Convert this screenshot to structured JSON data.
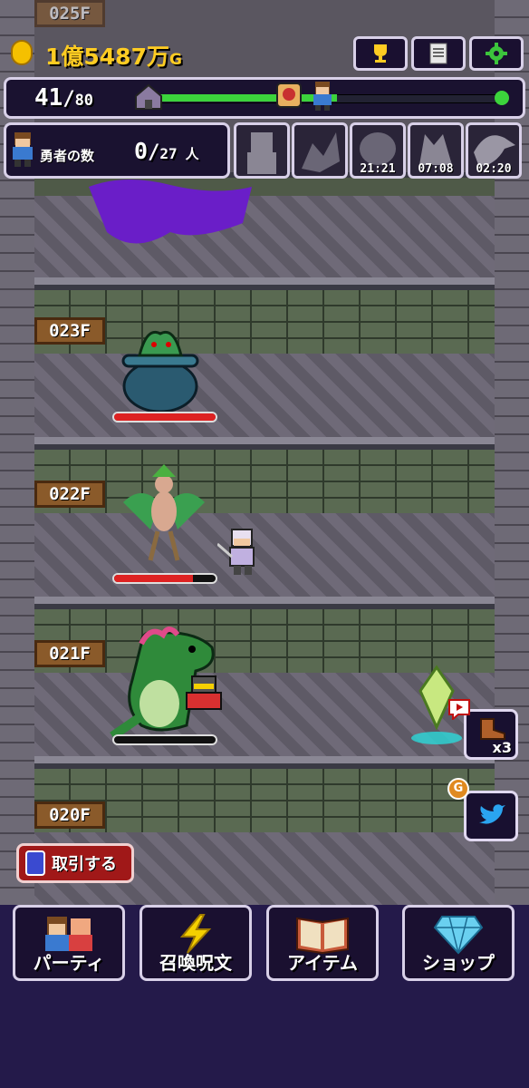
{
  "header": {
    "gold_amount": "1億5487万",
    "gold_unit": "G",
    "buttons": {
      "trophy": "trophy-icon",
      "quest": "document-icon",
      "settings": "gear-icon"
    }
  },
  "progress": {
    "current": "41",
    "separator": "/",
    "max": "80",
    "fraction": 0.5125
  },
  "heroes": {
    "label": "勇者の数",
    "count": "0",
    "separator": "/",
    "total": "27",
    "unit": "人"
  },
  "bosses": [
    {
      "name_icon": "knight-silhouette",
      "timer": ""
    },
    {
      "name_icon": "dragon-silhouette",
      "timer": ""
    },
    {
      "name_icon": "beast-silhouette",
      "timer": "21:21"
    },
    {
      "name_icon": "wolf-silhouette",
      "timer": "07:08"
    },
    {
      "name_icon": "bird-silhouette",
      "timer": "02:20"
    }
  ],
  "floors": [
    {
      "label": "025F",
      "monster": "purple-slime-puddle"
    },
    {
      "label": "023F",
      "monster": "pot-plant",
      "hp": 1.0
    },
    {
      "label": "022F",
      "monster": "harpy",
      "hp": 0.78
    },
    {
      "label": "021F",
      "monster": "green-dinosaur",
      "hp": 0.0
    },
    {
      "label": "020F",
      "monster": "none"
    }
  ],
  "side_buttons": {
    "boost_label": "x3",
    "twitter_badge": "G"
  },
  "trade": {
    "label": "取引する"
  },
  "nav": [
    {
      "label": "パーティ",
      "icon": "party-icon"
    },
    {
      "label": "召喚呪文",
      "icon": "lightning-icon"
    },
    {
      "label": "アイテム",
      "icon": "book-icon"
    },
    {
      "label": "ショップ",
      "icon": "diamond-icon"
    }
  ],
  "colors": {
    "gold": "#ffcc22",
    "hp": "#d22222",
    "progress": "#3cd43c",
    "nav_bg": "#241a4a"
  }
}
